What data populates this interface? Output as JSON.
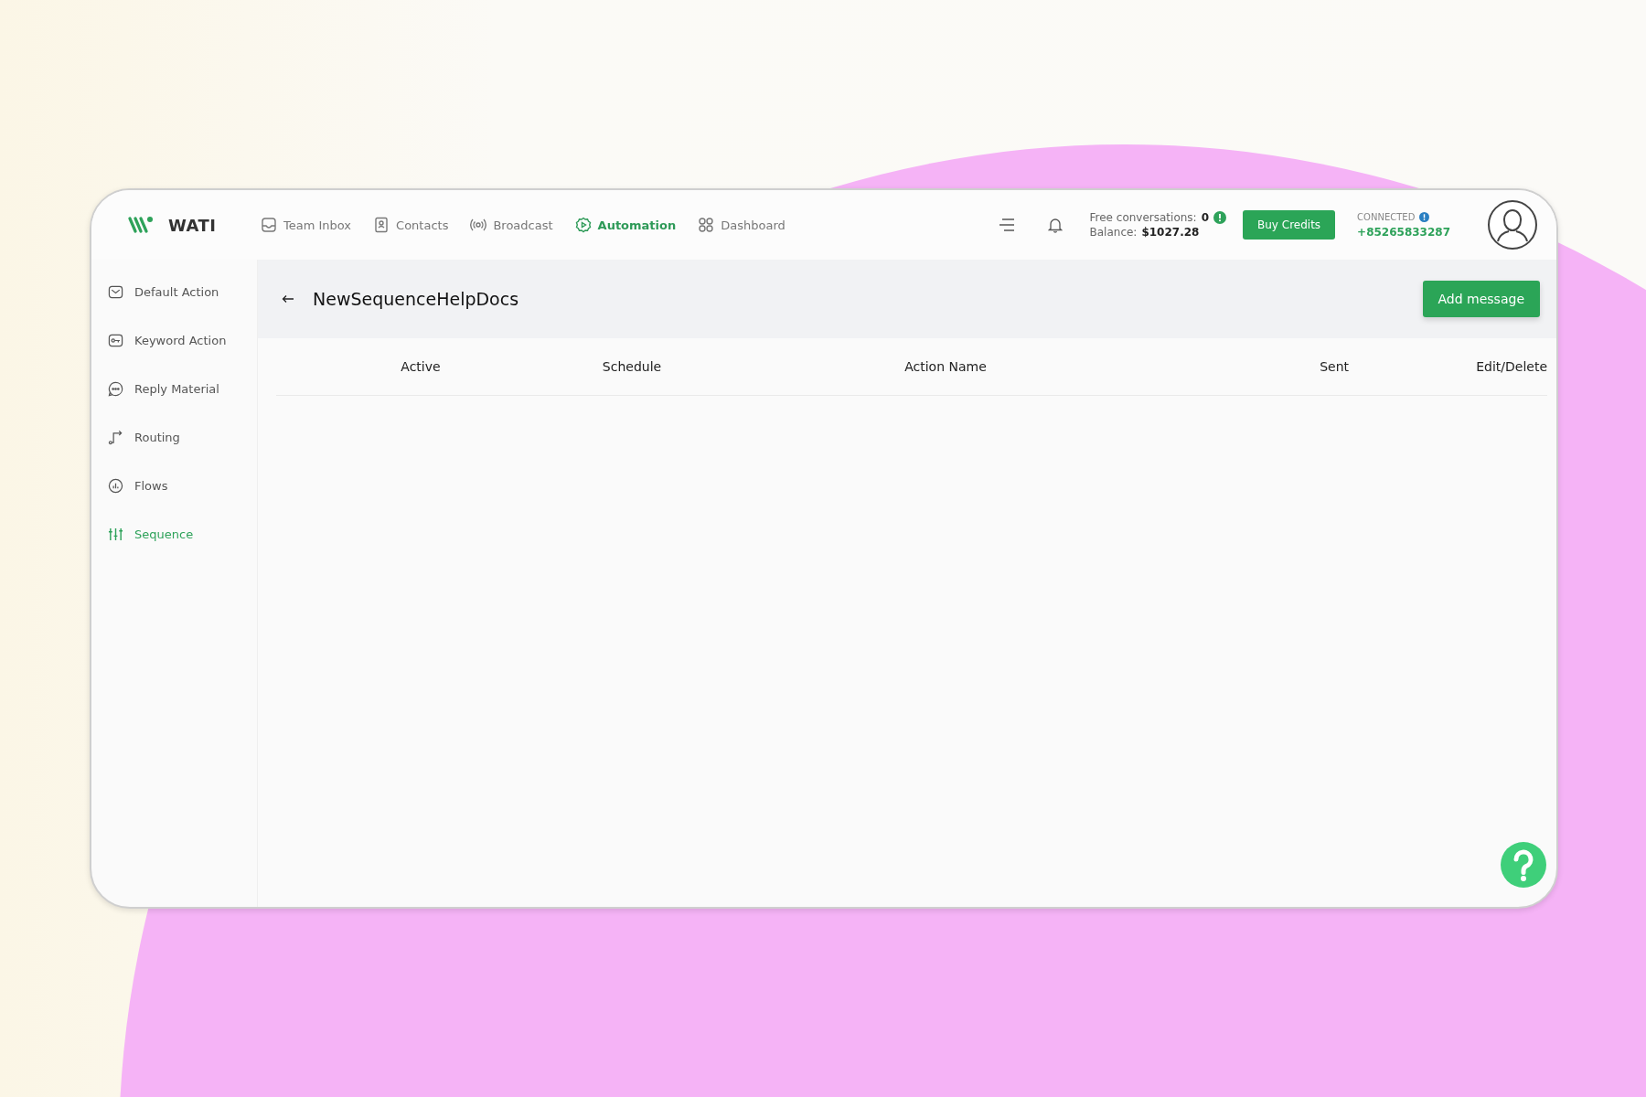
{
  "brand": {
    "name": "WATI"
  },
  "nav": [
    {
      "label": "Team Inbox",
      "selected": false
    },
    {
      "label": "Contacts",
      "selected": false
    },
    {
      "label": "Broadcast",
      "selected": false
    },
    {
      "label": "Automation",
      "selected": true
    },
    {
      "label": "Dashboard",
      "selected": false
    }
  ],
  "account": {
    "free_label": "Free conversations:",
    "free_count": "0",
    "balance_label": "Balance:",
    "balance": "$1027.28"
  },
  "buy_button": "Buy Credits",
  "connection": {
    "status": "CONNECTED",
    "phone": "+85265833287"
  },
  "sidebar": [
    {
      "label": "Default Action",
      "selected": false
    },
    {
      "label": "Keyword Action",
      "selected": false
    },
    {
      "label": "Reply Material",
      "selected": false
    },
    {
      "label": "Routing",
      "selected": false
    },
    {
      "label": "Flows",
      "selected": false
    },
    {
      "label": "Sequence",
      "selected": true
    }
  ],
  "page": {
    "title": "NewSequenceHelpDocs",
    "add_button": "Add message"
  },
  "table": {
    "columns": [
      "Active",
      "Schedule",
      "Action Name",
      "Sent",
      "Edit/Delete"
    ]
  }
}
